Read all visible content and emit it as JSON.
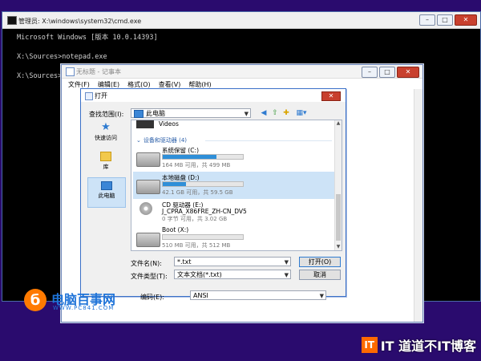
{
  "cmd": {
    "title": "管理员: X:\\windows\\system32\\cmd.exe",
    "lines": [
      "Microsoft Windows [版本 10.0.14393]",
      "",
      "X:\\Sources>notepad.exe",
      "",
      "X:\\Sources>"
    ]
  },
  "notepad": {
    "title": "无标题 - 记事本",
    "menu": [
      "文件(F)",
      "编辑(E)",
      "格式(O)",
      "查看(V)",
      "帮助(H)"
    ]
  },
  "dialog": {
    "title": "打开",
    "lookin_label": "查找范围(I):",
    "lookin_value": "此电脑",
    "places": [
      {
        "label": "快速访问",
        "icon": "star-icon"
      },
      {
        "label": "库",
        "icon": "library-icon"
      },
      {
        "label": "此电脑",
        "icon": "computer-icon",
        "active": true
      }
    ],
    "top_item": "Videos",
    "group": "设备和驱动器 (4)",
    "drives": [
      {
        "name": "系统保留 (C:)",
        "info": "164 MB 可用，共 499 MB",
        "used_pct": 67,
        "selected": false,
        "icon": "hard-drive-icon"
      },
      {
        "name": "本地磁盘 (D:)",
        "info": "42.1 GB 可用，共 59.5 GB",
        "used_pct": 29,
        "selected": true,
        "icon": "hard-drive-icon"
      },
      {
        "name": "CD 驱动器 (E:)",
        "subname": "J_CPRA_X86FRE_ZH-CN_DV5",
        "info": "0 字节 可用，共 3.02 GB",
        "selected": false,
        "icon": "cd-drive-icon"
      },
      {
        "name": "Boot (X:)",
        "info": "510 MB 可用，共 512 MB",
        "used_pct": 0,
        "selected": false,
        "icon": "hard-drive-icon"
      }
    ],
    "filename_label": "文件名(N):",
    "filename_value": "*.txt",
    "filetype_label": "文件类型(T):",
    "filetype_value": "文本文档(*.txt)",
    "encoding_label": "编码(E):",
    "encoding_value": "ANSI",
    "open_button": "打开(O)",
    "cancel_button": "取消"
  },
  "watermark_left": {
    "brand": "电脑百事网",
    "url": "WWW.PC841.COM"
  },
  "watermark_right": {
    "brand": "IT 道道不IT博客"
  },
  "colors": {
    "desktop": "#2a0b6e",
    "accent": "#2f8fd8",
    "close": "#c8402e"
  }
}
